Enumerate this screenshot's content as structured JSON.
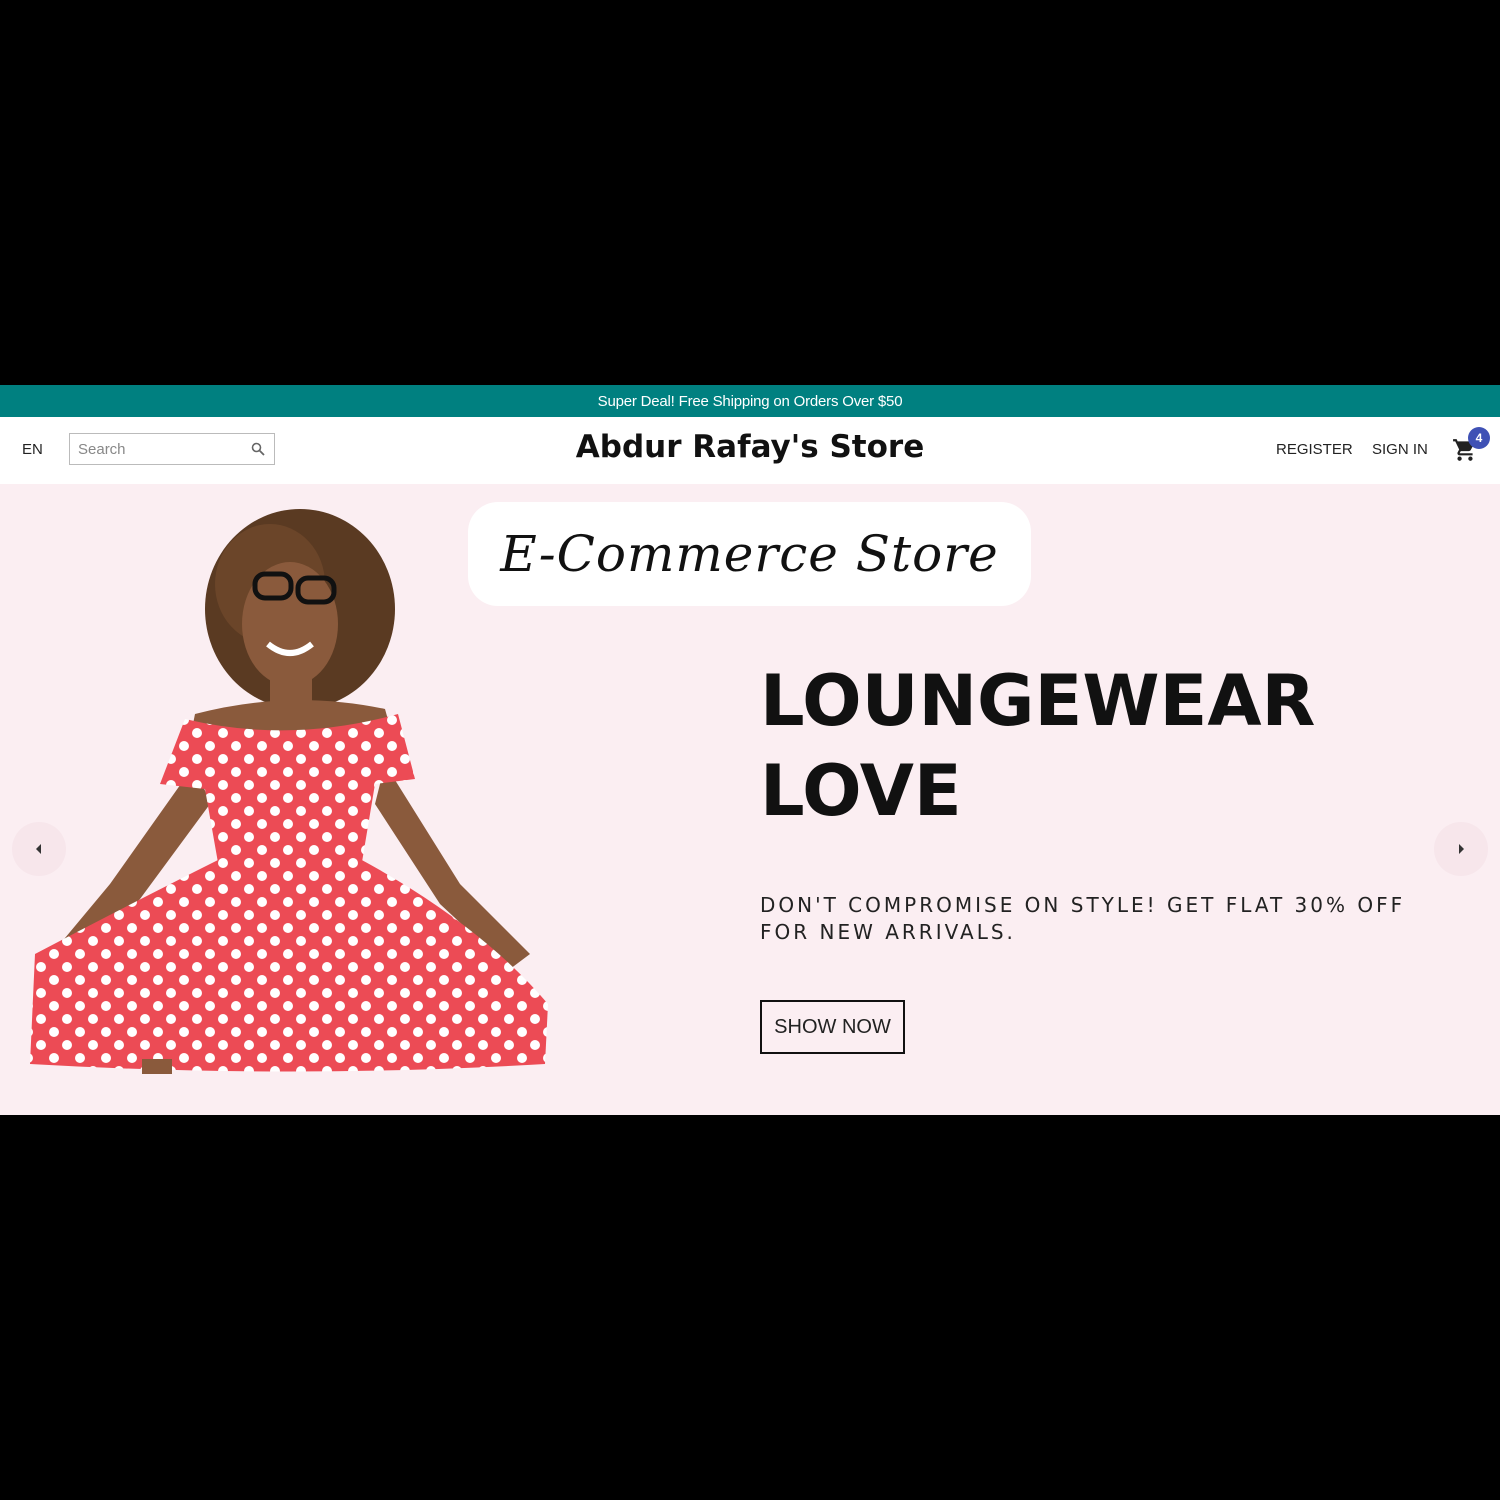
{
  "announcement": {
    "text": "Super Deal! Free Shipping on Orders Over $50"
  },
  "header": {
    "language": "EN",
    "search_placeholder": "Search",
    "brand": "Abdur Rafay's Store",
    "register": "REGISTER",
    "sign_in": "SIGN IN",
    "cart_count": "4"
  },
  "hero": {
    "pill_text": "E-Commerce Store",
    "title_line1": "LOUNGEWEAR",
    "title_line2": "LOVE",
    "description": "DON'T COMPROMISE ON STYLE! GET FLAT 30% OFF FOR NEW ARRIVALS.",
    "button": "SHOW NOW",
    "background_color": "#fbeef2"
  },
  "colors": {
    "announcement_bg": "#008080",
    "badge": "#3f51b5",
    "dress": "#ec4b55"
  },
  "icons": {
    "search": "search-icon",
    "cart": "shopping-cart-icon",
    "prev": "arrow-left-icon",
    "next": "arrow-right-icon"
  }
}
